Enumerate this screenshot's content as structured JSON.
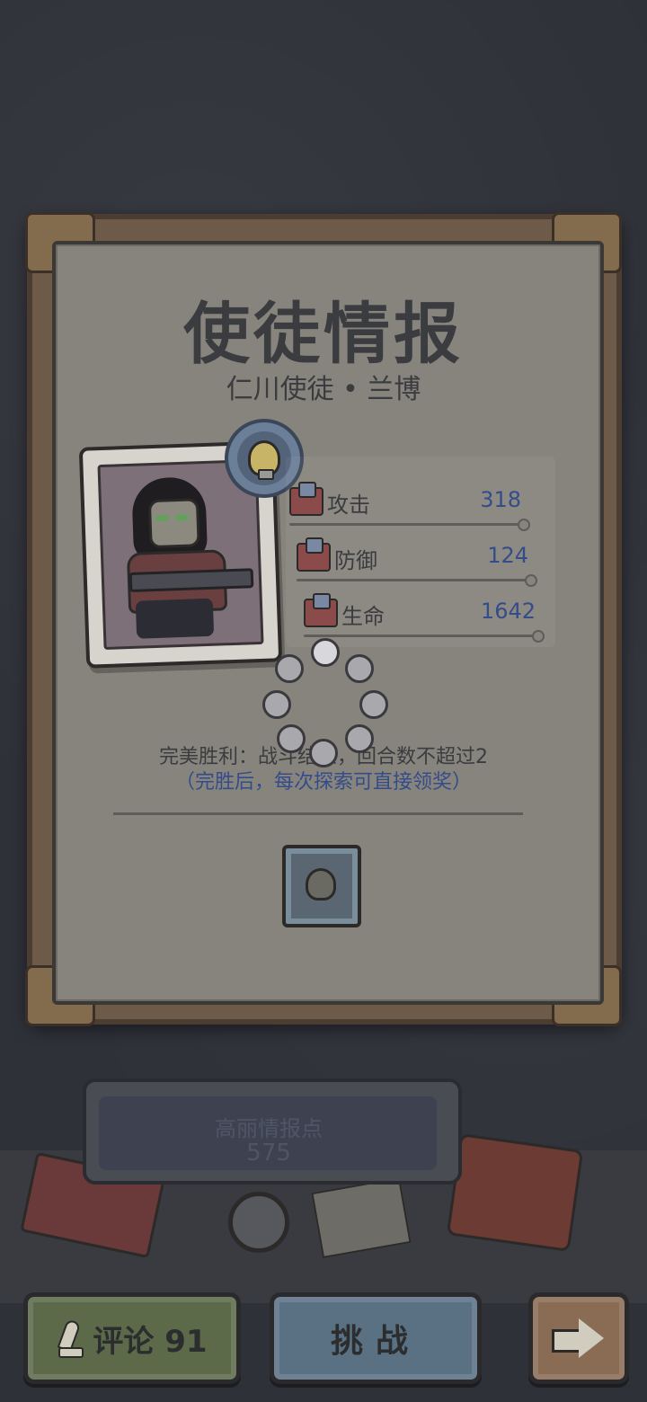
{
  "info_panel": {
    "title": "使徒情报",
    "subtitle": "仁川使徒 • 兰博",
    "stats": [
      {
        "label": "攻击",
        "value": "318",
        "icon": "sword-icon"
      },
      {
        "label": "防御",
        "value": "124",
        "icon": "shield-icon"
      },
      {
        "label": "生命",
        "value": "1642",
        "icon": "heart-icon"
      }
    ],
    "victory_condition": "完美胜利：战斗结束，回合数不超过2",
    "victory_note": "（完胜后，每次探索可直接领奖）"
  },
  "intel_board": {
    "label": "高丽情报点",
    "value": "575"
  },
  "buttons": {
    "comment_label": "评论 91",
    "challenge_label": "挑战",
    "next_icon": "arrow-right-icon"
  },
  "colors": {
    "stat_value": "#354c8a",
    "victory_note": "#354c8a",
    "background": "#2f3139"
  }
}
